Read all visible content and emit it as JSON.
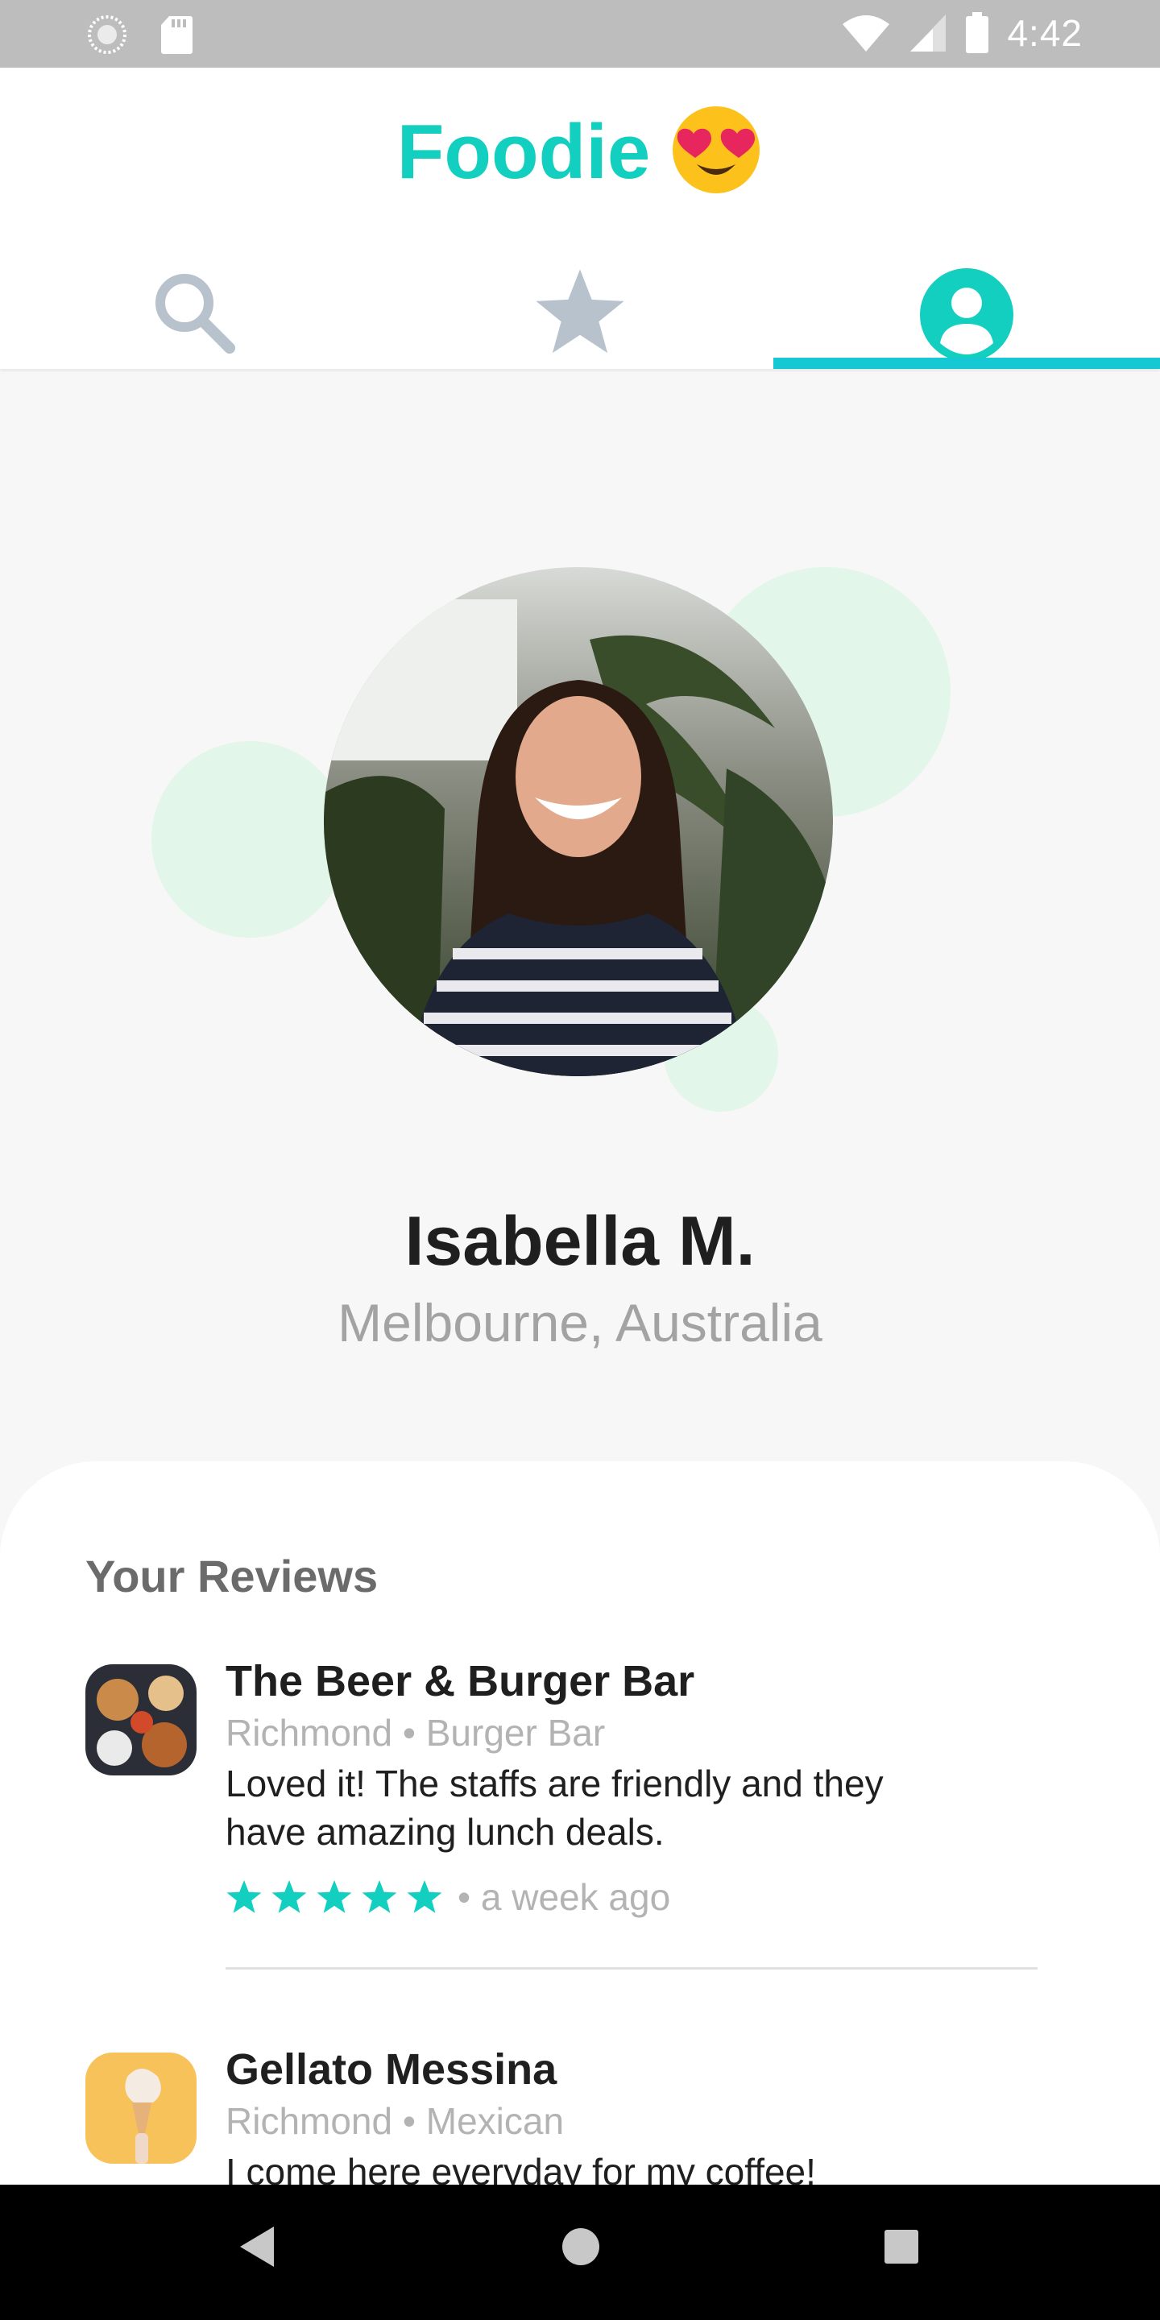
{
  "status_bar": {
    "time": "4:42"
  },
  "app": {
    "title": "Foodie"
  },
  "tabs": [
    {
      "icon": "search-icon"
    },
    {
      "icon": "star-icon"
    },
    {
      "icon": "profile-icon",
      "active": true
    }
  ],
  "profile": {
    "name": "Isabella M.",
    "location": "Melbourne, Australia"
  },
  "reviews": {
    "title": "Your Reviews",
    "items": [
      {
        "name": "The Beer & Burger Bar",
        "meta": "Richmond • Burger Bar",
        "text_line1": "Loved it! The staffs are friendly and they",
        "text_line2": "have amazing lunch deals.",
        "rating": 5,
        "age": "• a week ago"
      },
      {
        "name": "Gellato Messina",
        "meta": "Richmond • Mexican",
        "text_line1": "I come here everyday for my coffee!"
      }
    ]
  },
  "colors": {
    "accent": "#12cfbf",
    "tab_indicator": "#15c8d3",
    "inactive_icon": "#b8c2cc",
    "bubble": "#e3f6ea"
  }
}
